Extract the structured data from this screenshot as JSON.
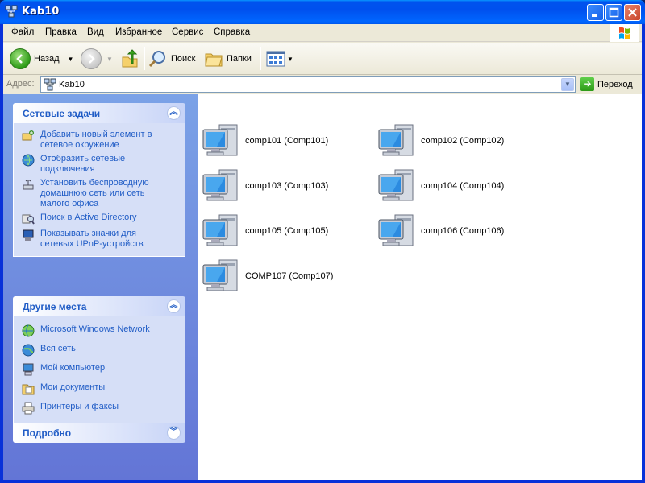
{
  "window": {
    "title": "Kab10"
  },
  "menu": [
    {
      "label": "Файл"
    },
    {
      "label": "Правка"
    },
    {
      "label": "Вид"
    },
    {
      "label": "Избранное"
    },
    {
      "label": "Сервис"
    },
    {
      "label": "Справка"
    }
  ],
  "toolbar": {
    "back_label": "Назад",
    "search_label": "Поиск",
    "folders_label": "Папки"
  },
  "address": {
    "label": "Адрес:",
    "value": "Kab10",
    "go_label": "Переход"
  },
  "panels": {
    "network_tasks": {
      "title": "Сетевые задачи",
      "items": [
        {
          "label": "Добавить новый элемент в\nсетевое окружение",
          "icon": "add-network-place-icon"
        },
        {
          "label": "Отобразить сетевые\nподключения",
          "icon": "network-connections-icon"
        },
        {
          "label": "Установить беспроводную\nдомашнюю сеть или сеть\nмалого офиса",
          "icon": "wireless-network-icon"
        },
        {
          "label": "Поиск в Active Directory",
          "icon": "active-directory-search-icon"
        },
        {
          "label": "Показывать значки для\nсетевых UPnP-устройств",
          "icon": "upnp-devices-icon"
        }
      ]
    },
    "other_places": {
      "title": "Другие места",
      "items": [
        {
          "label": "Microsoft Windows Network",
          "icon": "windows-network-icon"
        },
        {
          "label": "Вся сеть",
          "icon": "entire-network-icon"
        },
        {
          "label": "Мой компьютер",
          "icon": "my-computer-icon"
        },
        {
          "label": "Мои документы",
          "icon": "my-documents-icon"
        },
        {
          "label": "Принтеры и факсы",
          "icon": "printers-faxes-icon"
        }
      ]
    },
    "details": {
      "title": "Подробно"
    }
  },
  "computers": [
    {
      "label": "comp101 (Comp101)"
    },
    {
      "label": "comp102 (Comp102)"
    },
    {
      "label": "comp103 (Comp103)"
    },
    {
      "label": "comp104 (Comp104)"
    },
    {
      "label": "comp105 (Comp105)"
    },
    {
      "label": "comp106 (Comp106)"
    },
    {
      "label": "COMP107 (Comp107)"
    }
  ]
}
